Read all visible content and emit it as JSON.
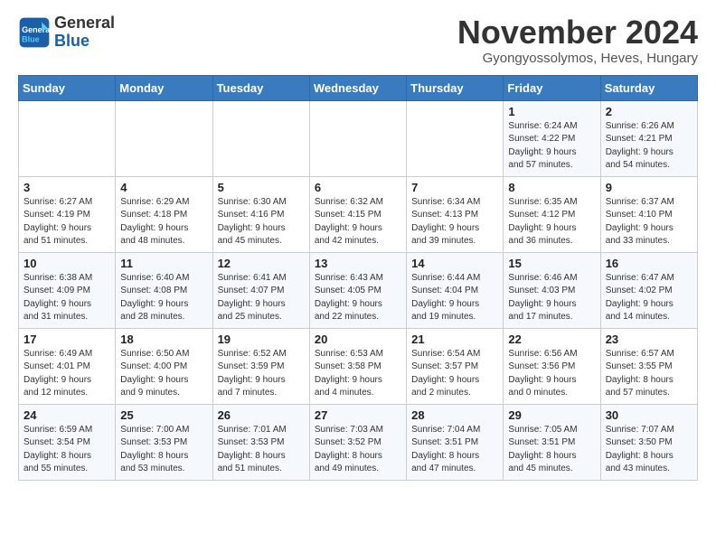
{
  "header": {
    "logo_line1": "General",
    "logo_line2": "Blue",
    "month": "November 2024",
    "location": "Gyongyossolymos, Heves, Hungary"
  },
  "weekdays": [
    "Sunday",
    "Monday",
    "Tuesday",
    "Wednesday",
    "Thursday",
    "Friday",
    "Saturday"
  ],
  "weeks": [
    [
      {
        "day": "",
        "info": ""
      },
      {
        "day": "",
        "info": ""
      },
      {
        "day": "",
        "info": ""
      },
      {
        "day": "",
        "info": ""
      },
      {
        "day": "",
        "info": ""
      },
      {
        "day": "1",
        "info": "Sunrise: 6:24 AM\nSunset: 4:22 PM\nDaylight: 9 hours\nand 57 minutes."
      },
      {
        "day": "2",
        "info": "Sunrise: 6:26 AM\nSunset: 4:21 PM\nDaylight: 9 hours\nand 54 minutes."
      }
    ],
    [
      {
        "day": "3",
        "info": "Sunrise: 6:27 AM\nSunset: 4:19 PM\nDaylight: 9 hours\nand 51 minutes."
      },
      {
        "day": "4",
        "info": "Sunrise: 6:29 AM\nSunset: 4:18 PM\nDaylight: 9 hours\nand 48 minutes."
      },
      {
        "day": "5",
        "info": "Sunrise: 6:30 AM\nSunset: 4:16 PM\nDaylight: 9 hours\nand 45 minutes."
      },
      {
        "day": "6",
        "info": "Sunrise: 6:32 AM\nSunset: 4:15 PM\nDaylight: 9 hours\nand 42 minutes."
      },
      {
        "day": "7",
        "info": "Sunrise: 6:34 AM\nSunset: 4:13 PM\nDaylight: 9 hours\nand 39 minutes."
      },
      {
        "day": "8",
        "info": "Sunrise: 6:35 AM\nSunset: 4:12 PM\nDaylight: 9 hours\nand 36 minutes."
      },
      {
        "day": "9",
        "info": "Sunrise: 6:37 AM\nSunset: 4:10 PM\nDaylight: 9 hours\nand 33 minutes."
      }
    ],
    [
      {
        "day": "10",
        "info": "Sunrise: 6:38 AM\nSunset: 4:09 PM\nDaylight: 9 hours\nand 31 minutes."
      },
      {
        "day": "11",
        "info": "Sunrise: 6:40 AM\nSunset: 4:08 PM\nDaylight: 9 hours\nand 28 minutes."
      },
      {
        "day": "12",
        "info": "Sunrise: 6:41 AM\nSunset: 4:07 PM\nDaylight: 9 hours\nand 25 minutes."
      },
      {
        "day": "13",
        "info": "Sunrise: 6:43 AM\nSunset: 4:05 PM\nDaylight: 9 hours\nand 22 minutes."
      },
      {
        "day": "14",
        "info": "Sunrise: 6:44 AM\nSunset: 4:04 PM\nDaylight: 9 hours\nand 19 minutes."
      },
      {
        "day": "15",
        "info": "Sunrise: 6:46 AM\nSunset: 4:03 PM\nDaylight: 9 hours\nand 17 minutes."
      },
      {
        "day": "16",
        "info": "Sunrise: 6:47 AM\nSunset: 4:02 PM\nDaylight: 9 hours\nand 14 minutes."
      }
    ],
    [
      {
        "day": "17",
        "info": "Sunrise: 6:49 AM\nSunset: 4:01 PM\nDaylight: 9 hours\nand 12 minutes."
      },
      {
        "day": "18",
        "info": "Sunrise: 6:50 AM\nSunset: 4:00 PM\nDaylight: 9 hours\nand 9 minutes."
      },
      {
        "day": "19",
        "info": "Sunrise: 6:52 AM\nSunset: 3:59 PM\nDaylight: 9 hours\nand 7 minutes."
      },
      {
        "day": "20",
        "info": "Sunrise: 6:53 AM\nSunset: 3:58 PM\nDaylight: 9 hours\nand 4 minutes."
      },
      {
        "day": "21",
        "info": "Sunrise: 6:54 AM\nSunset: 3:57 PM\nDaylight: 9 hours\nand 2 minutes."
      },
      {
        "day": "22",
        "info": "Sunrise: 6:56 AM\nSunset: 3:56 PM\nDaylight: 9 hours\nand 0 minutes."
      },
      {
        "day": "23",
        "info": "Sunrise: 6:57 AM\nSunset: 3:55 PM\nDaylight: 8 hours\nand 57 minutes."
      }
    ],
    [
      {
        "day": "24",
        "info": "Sunrise: 6:59 AM\nSunset: 3:54 PM\nDaylight: 8 hours\nand 55 minutes."
      },
      {
        "day": "25",
        "info": "Sunrise: 7:00 AM\nSunset: 3:53 PM\nDaylight: 8 hours\nand 53 minutes."
      },
      {
        "day": "26",
        "info": "Sunrise: 7:01 AM\nSunset: 3:53 PM\nDaylight: 8 hours\nand 51 minutes."
      },
      {
        "day": "27",
        "info": "Sunrise: 7:03 AM\nSunset: 3:52 PM\nDaylight: 8 hours\nand 49 minutes."
      },
      {
        "day": "28",
        "info": "Sunrise: 7:04 AM\nSunset: 3:51 PM\nDaylight: 8 hours\nand 47 minutes."
      },
      {
        "day": "29",
        "info": "Sunrise: 7:05 AM\nSunset: 3:51 PM\nDaylight: 8 hours\nand 45 minutes."
      },
      {
        "day": "30",
        "info": "Sunrise: 7:07 AM\nSunset: 3:50 PM\nDaylight: 8 hours\nand 43 minutes."
      }
    ]
  ]
}
